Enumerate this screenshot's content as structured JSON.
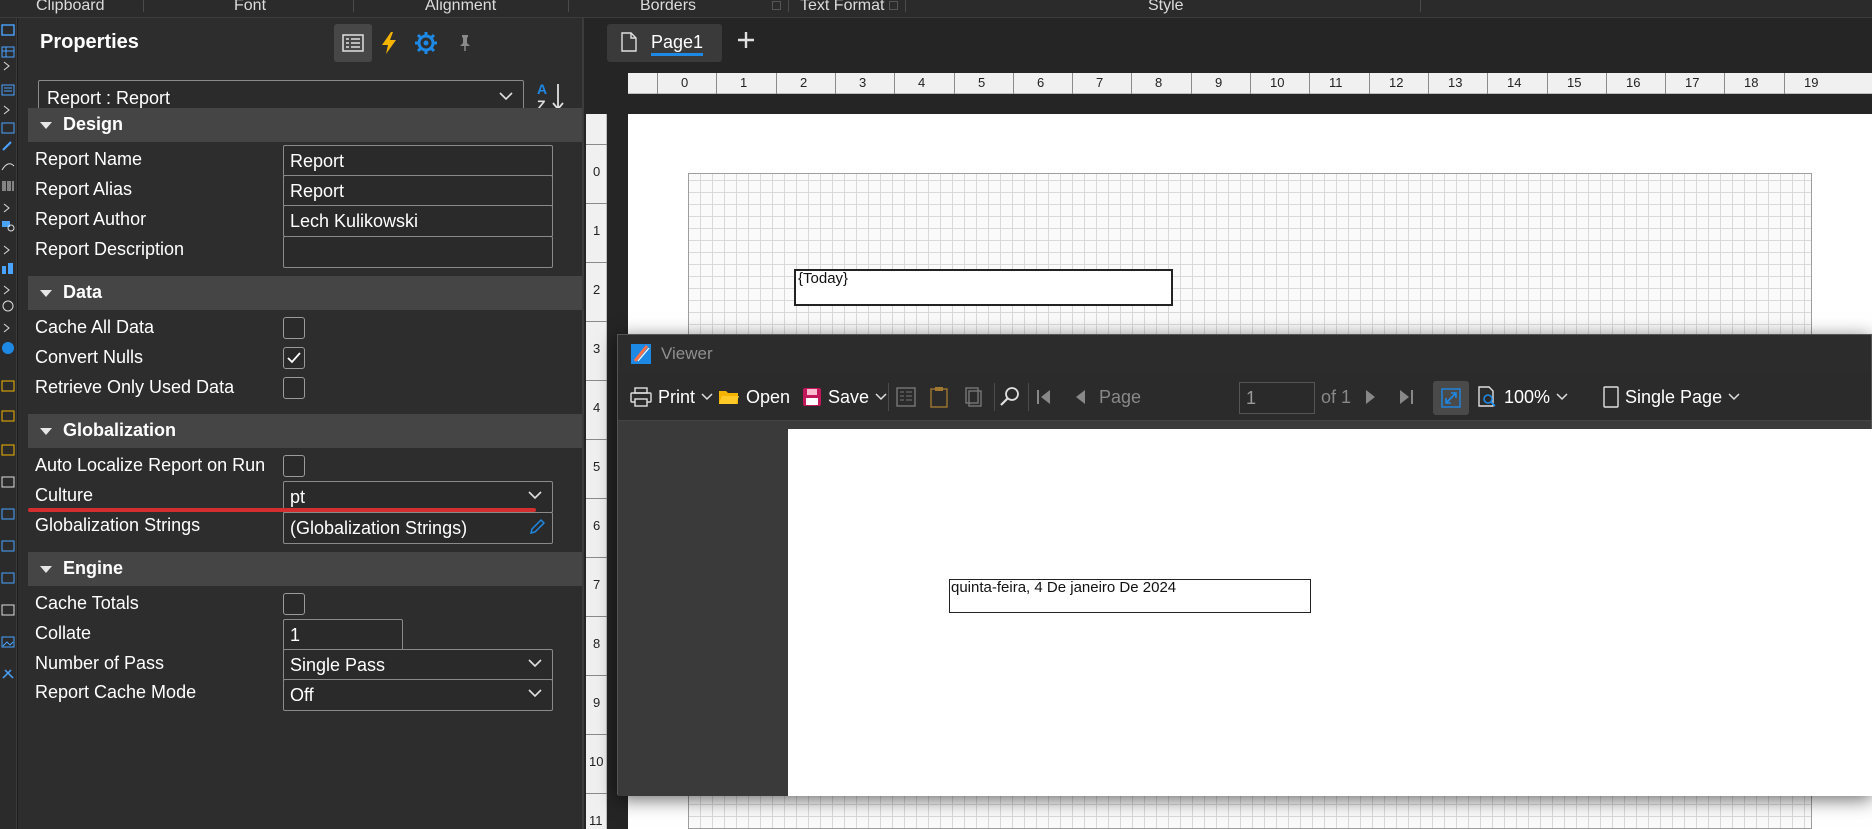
{
  "ribbon": {
    "groups": [
      "Clipboard",
      "Font",
      "Alignment",
      "Borders",
      "Text Format",
      "Style"
    ]
  },
  "properties": {
    "title": "Properties",
    "object_selector": "Report : Report",
    "sections": {
      "design": {
        "title": "Design",
        "report_name_label": "Report Name",
        "report_name_value": "Report",
        "report_alias_label": "Report Alias",
        "report_alias_value": "Report",
        "report_author_label": "Report Author",
        "report_author_value": "Lech Kulikowski",
        "report_description_label": "Report Description",
        "report_description_value": ""
      },
      "data": {
        "title": "Data",
        "cache_all_data_label": "Cache All Data",
        "cache_all_data_checked": false,
        "convert_nulls_label": "Convert Nulls",
        "convert_nulls_checked": true,
        "retrieve_only_used_label": "Retrieve Only Used Data",
        "retrieve_only_used_checked": false
      },
      "globalization": {
        "title": "Globalization",
        "auto_localize_label": "Auto Localize Report on Run",
        "auto_localize_checked": false,
        "culture_label": "Culture",
        "culture_value": "pt",
        "glob_strings_label": "Globalization Strings",
        "glob_strings_value": "(Globalization Strings)"
      },
      "engine": {
        "title": "Engine",
        "cache_totals_label": "Cache Totals",
        "cache_totals_checked": false,
        "collate_label": "Collate",
        "collate_value": "1",
        "number_of_pass_label": "Number of Pass",
        "number_of_pass_value": "Single Pass",
        "report_cache_mode_label": "Report Cache Mode",
        "report_cache_mode_value": "Off"
      }
    }
  },
  "designer": {
    "tab_label": "Page1",
    "ruler_h": [
      "0",
      "1",
      "2",
      "3",
      "4",
      "5",
      "6",
      "7",
      "8",
      "9",
      "10",
      "11",
      "12",
      "13",
      "14",
      "15",
      "16",
      "17",
      "18",
      "19"
    ],
    "ruler_v": [
      "0",
      "1",
      "2",
      "3",
      "4",
      "5",
      "6",
      "7",
      "8",
      "9",
      "10",
      "11"
    ],
    "today_expression": "{Today}"
  },
  "viewer": {
    "title": "Viewer",
    "print_label": "Print",
    "open_label": "Open",
    "save_label": "Save",
    "page_label": "Page",
    "page_value": "1",
    "of_label": "of 1",
    "zoom_label": "100%",
    "view_mode_label": "Single Page",
    "date_text": "quinta-feira, 4 De janeiro De 2024"
  },
  "colors": {
    "accent": "#1e88e5",
    "highlight_underline": "#d32f2f",
    "panel_bg": "#2d2d2d",
    "section_bg": "#454545",
    "event_icon": "#f5b400"
  }
}
